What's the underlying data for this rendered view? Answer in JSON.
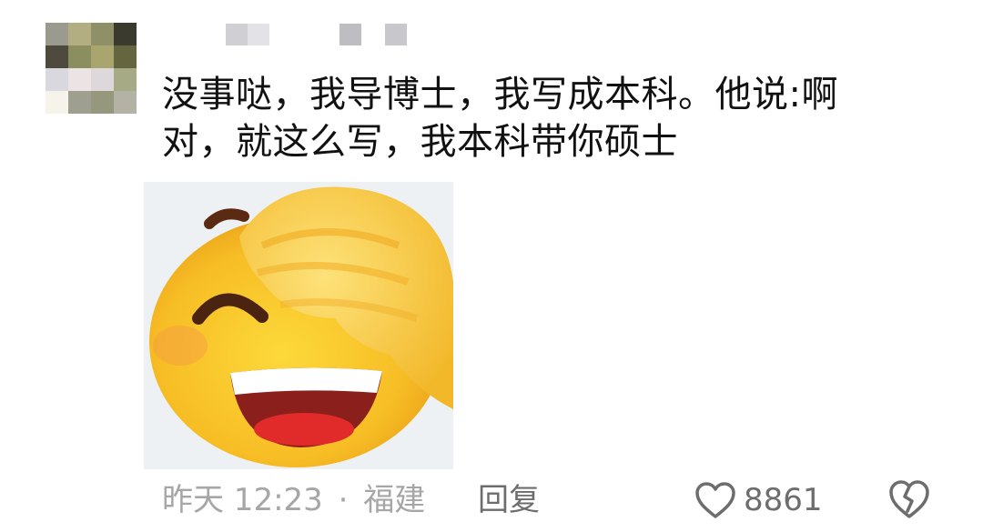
{
  "comment": {
    "text_line1": "没事哒，我导博士，我写成本科。他说:啊",
    "text_line2": "对，就这么写，我本科带你硕士"
  },
  "meta": {
    "time": "昨天 12:23",
    "separator": "·",
    "location": "福建"
  },
  "actions": {
    "reply_label": "回复",
    "like_count": "8861"
  },
  "icons": {
    "like": "heart-outline-icon",
    "dislike": "broken-heart-icon"
  },
  "colors": {
    "text": "#111111",
    "meta": "#a6a6a6",
    "action": "#6d6d6d",
    "emoji_face": "#f9c12c"
  }
}
